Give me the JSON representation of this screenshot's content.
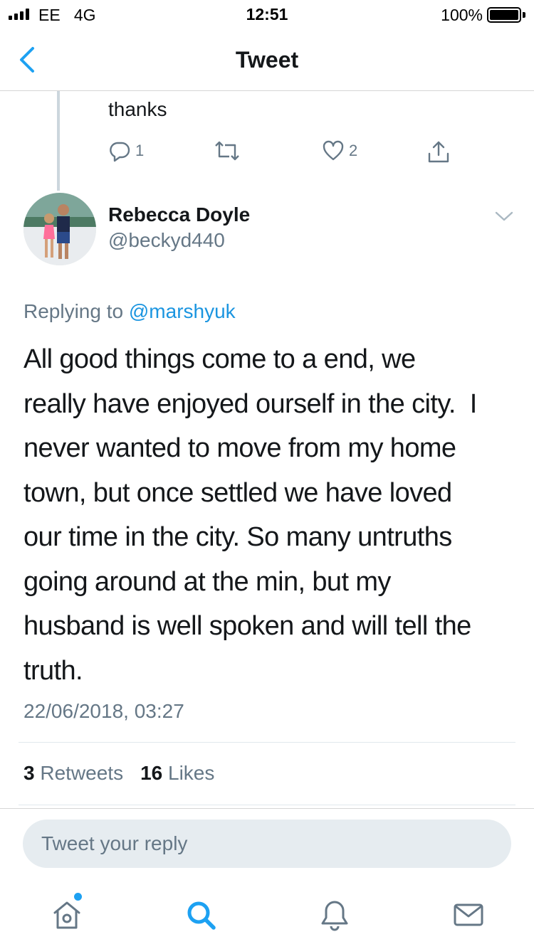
{
  "status_bar": {
    "carrier": "EE   4G",
    "time": "12:51",
    "battery": "100%"
  },
  "nav": {
    "title": "Tweet"
  },
  "previous_tweet": {
    "text": "thanks",
    "replies": "1",
    "likes": "2"
  },
  "author": {
    "name": "Rebecca Doyle",
    "handle": "@beckyd440"
  },
  "tweet": {
    "replying_prefix": "Replying to",
    "replying_to": "@marshyuk",
    "lines": [
      "All good things come to a end, we",
      "really have enjoyed ourself in the city.  I",
      "never wanted to move from my home",
      "town, but once settled we have loved",
      "our time in the city. So many untruths",
      "going around at the min, but my",
      "husband is well spoken and will tell the",
      "truth."
    ],
    "timestamp": "22/06/2018, 03:27",
    "retweets_count": "3",
    "retweets_label": "Retweets",
    "likes_count": "16",
    "likes_label": "Likes"
  },
  "reply": {
    "placeholder": "Tweet your reply"
  },
  "colors": {
    "accent": "#1da1f2",
    "mention": "#1b95e0",
    "secondary_text": "#657786"
  },
  "icons": {
    "back": "chevron-left-icon",
    "reply": "comment-icon",
    "retweet": "retweet-icon",
    "like": "heart-icon",
    "share": "share-icon",
    "more": "chevron-down-icon",
    "home": "home-icon",
    "search": "search-icon",
    "notifications": "bell-icon",
    "messages": "envelope-icon"
  }
}
